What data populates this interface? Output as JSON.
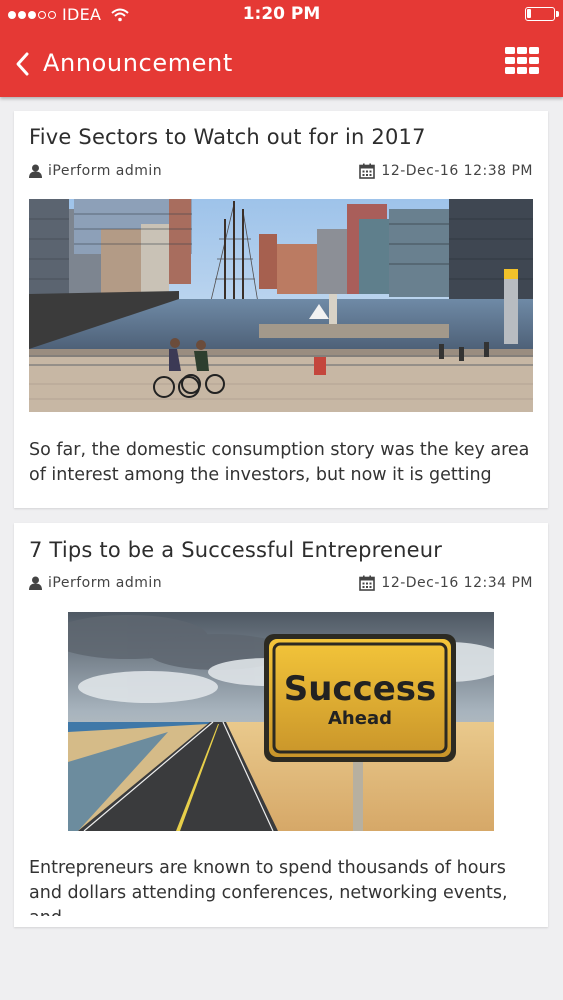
{
  "status_bar": {
    "carrier": "IDEA",
    "time": "1:20 PM",
    "signal_icon": "signal-dots-icon",
    "wifi_icon": "wifi-icon",
    "battery_icon": "battery-icon",
    "battery_level": 0.15
  },
  "header": {
    "title": "Announcement",
    "back_icon": "chevron-left-icon",
    "menu_icon": "grid-menu-icon",
    "background_color": "#e53935"
  },
  "announcements": [
    {
      "title": "Five Sectors to Watch out for in 2017",
      "author": "iPerform admin",
      "date": "12-Dec-16 12:38 PM",
      "image_description_icon": "harbor-photo",
      "excerpt": "So far, the domestic consumption story was the key area of interest among the investors, but now it is getting"
    },
    {
      "title": "7 Tips to be a Successful Entrepreneur",
      "author": "iPerform admin",
      "date": "12-Dec-16 12:34 PM",
      "image_description_icon": "success-sign-photo",
      "image_sign_line1": "Success",
      "image_sign_line2": "Ahead",
      "excerpt": "Entrepreneurs are known to spend thousands of hours and dollars attending conferences, networking events, and"
    }
  ]
}
